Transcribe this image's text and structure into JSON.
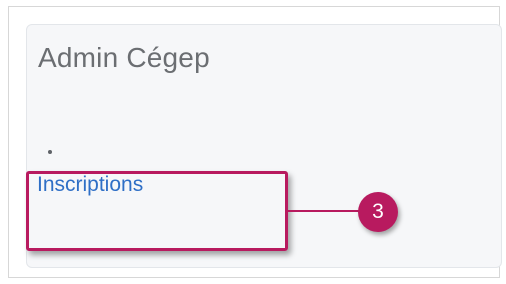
{
  "card": {
    "title": "Admin Cégep"
  },
  "menu": {
    "items": [
      {
        "label": "Inscriptions"
      }
    ]
  },
  "callout": {
    "number": "3",
    "color": "#b81a5f"
  },
  "colors": {
    "link": "#2f6fc6",
    "title": "#6b6e72",
    "card_background": "#f6f7f9"
  }
}
